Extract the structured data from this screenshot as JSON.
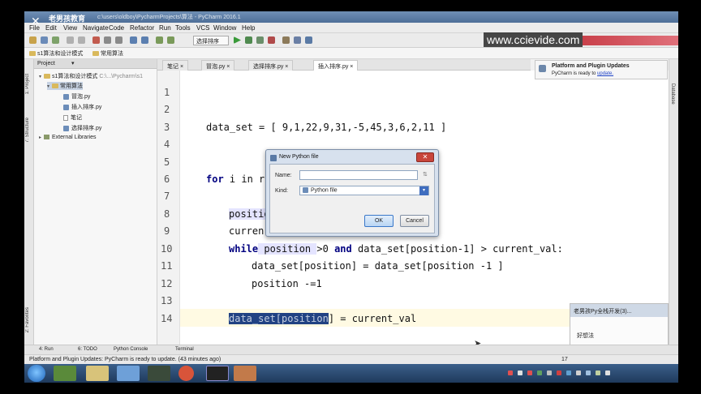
{
  "watermark": "www.ccievide.com",
  "logo": {
    "name": "老男孩教育",
    "url": "oldboyedu.com"
  },
  "window_title": "c:\\users\\oldboy\\PycharmProjects\\算法 - PyCharm 2016.1",
  "menu": [
    "File",
    "Edit",
    "View",
    "Navigate",
    "Code",
    "Refactor",
    "Run",
    "Tools",
    "VCS",
    "Window",
    "Help"
  ],
  "toolbar": {
    "run_config": "选择排序"
  },
  "breadcrumb": [
    "s1算法和设计模式",
    "常用算法"
  ],
  "project_panel": {
    "title": "Project",
    "items": [
      {
        "label": "s1算法和设计模式",
        "type": "folder",
        "suffix": "C:\\...\\Pycharm\\s1"
      },
      {
        "label": "常用算法",
        "type": "folder"
      },
      {
        "label": "冒泡.py",
        "type": "py"
      },
      {
        "label": "插入排序.py",
        "type": "py"
      },
      {
        "label": "笔记",
        "type": "txt"
      },
      {
        "label": "选择排序.py",
        "type": "py"
      },
      {
        "label": "External Libraries",
        "type": "lib"
      }
    ]
  },
  "side_tabs": {
    "left": [
      "1: Project",
      "7: Structure",
      "2: Favorites"
    ],
    "right": [
      "Database"
    ]
  },
  "editor_tabs": [
    {
      "label": "笔记",
      "active": false
    },
    {
      "label": "冒泡.py",
      "active": false
    },
    {
      "label": "选择排序.py",
      "active": false
    },
    {
      "label": "插入排序.py",
      "active": true
    }
  ],
  "editor": {
    "line_numbers": [
      "1",
      "2",
      "3",
      "4",
      "5",
      "6",
      "7",
      "8",
      "9",
      "10",
      "11",
      "12",
      "13",
      "14"
    ],
    "code": {
      "l3": "data_set = [ 9,1,22,9,31,-5,45,3,6,2,11 ]",
      "l6_kw1": "for",
      "l6_rest": " i in r",
      "l8": "positio",
      "l9": "curren",
      "l10_kw": "while",
      "l10_a": " position ",
      "l10_b": ">0 ",
      "l10_and": "and",
      "l10_c": " data_set[position-1] > current_val:",
      "l11": "data_set[position] = data_set[position -1 ]",
      "l12": "position -=1",
      "l14_sel": "data_set[position",
      "l14_rest": "] = current_val"
    }
  },
  "notification": {
    "title": "Platform and Plugin Updates",
    "text": "PyCharm is ready to ",
    "link": "update."
  },
  "popup": {
    "title": "老男孩Py全栈开发(3)...",
    "body": "好想法"
  },
  "dialog": {
    "title": "New Python file",
    "name_label": "Name:",
    "name_value": "",
    "kind_label": "Kind:",
    "kind_value": "Python file",
    "ok": "OK",
    "cancel": "Cancel"
  },
  "bottom_tabs": [
    "4: Run",
    "6: TODO",
    "Python Console",
    "Terminal"
  ],
  "status": {
    "message": "Platform and Plugin Updates: PyCharm is ready to update. (43 minutes ago)",
    "position": "17"
  },
  "colors": {
    "selection": "#214283",
    "current_line": "#fffae3",
    "keyword": "#000080",
    "accent": "#3f6dbf"
  }
}
